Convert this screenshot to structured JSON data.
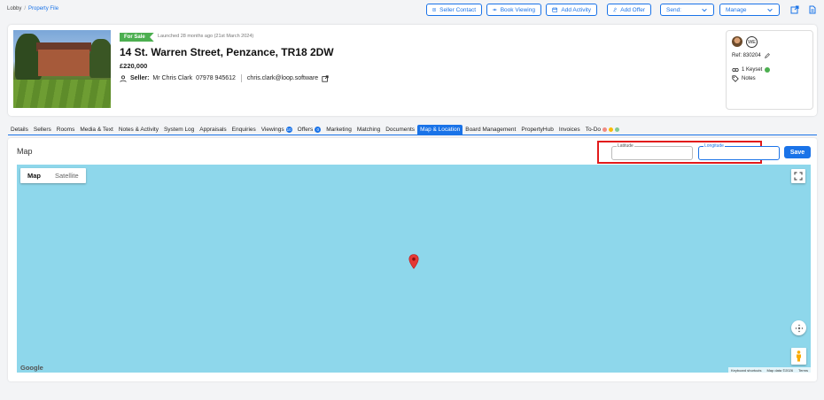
{
  "breadcrumb": {
    "root": "Lobby",
    "separator": "/",
    "current": "Property File"
  },
  "toolbar": {
    "seller_contact": "Seller Contact",
    "book_viewing": "Book Viewing",
    "add_activity": "Add Activity",
    "add_offer": "Add Offer",
    "send": "Send:",
    "manage": "Manage"
  },
  "property": {
    "status": "For Sale",
    "launched": "Launched 28 months ago (21st March 2024)",
    "address": "14 St. Warren Street, Penzance, TR18 2DW",
    "price": "£220,000",
    "seller_label": "Seller:",
    "seller_name": "Mr Chris Clark",
    "phone": "07978 945612",
    "email": "chris.clark@loop.software"
  },
  "side": {
    "initials": "WE",
    "ref": "Ref: 830204",
    "keyset": "1 Keyset",
    "notes": "Notes"
  },
  "tabs": [
    {
      "label": "Details"
    },
    {
      "label": "Sellers"
    },
    {
      "label": "Rooms"
    },
    {
      "label": "Media & Text"
    },
    {
      "label": "Notes & Activity"
    },
    {
      "label": "System Log"
    },
    {
      "label": "Appraisals"
    },
    {
      "label": "Enquiries"
    },
    {
      "label": "Viewings",
      "count": "10"
    },
    {
      "label": "Offers",
      "count": "0"
    },
    {
      "label": "Marketing"
    },
    {
      "label": "Matching"
    },
    {
      "label": "Documents"
    },
    {
      "label": "Map & Location",
      "active": true
    },
    {
      "label": "Board Management"
    },
    {
      "label": "PropertyHub"
    },
    {
      "label": "Invoices"
    },
    {
      "label": "To-Do"
    }
  ],
  "todo_dot_colors": [
    "#f28b82",
    "#fbbc04",
    "#81c995"
  ],
  "map_panel": {
    "title": "Map",
    "latitude_label": "Latitude",
    "latitude_value": "",
    "longitude_label": "Longitude",
    "longitude_value": "",
    "save_label": "Save",
    "map_type_map": "Map",
    "map_type_satellite": "Satellite",
    "google": "Google",
    "keyboard_shortcuts": "Keyboard shortcuts",
    "map_data": "Map data ©2026",
    "terms": "Terms"
  },
  "colors": {
    "accent": "#1a73e8",
    "status_green": "#4caf50",
    "highlight_red": "#e21b1b",
    "water": "#8ed7eb"
  }
}
